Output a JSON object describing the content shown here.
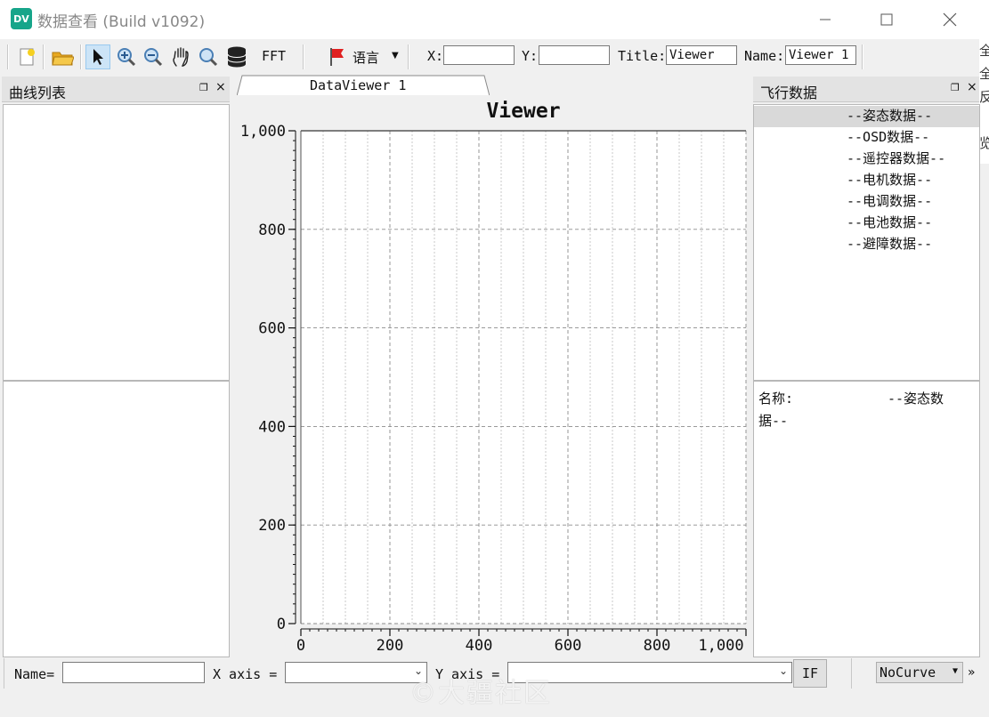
{
  "window": {
    "icon_text": "DV",
    "title": "数据查看  (Build v1092)",
    "accent": "#17a58a"
  },
  "toolbar": {
    "fft_label": "FFT",
    "language_label": "语言",
    "x_label": "X:",
    "x_value": "",
    "y_label": "Y:",
    "y_value": "",
    "title_label": "Title:",
    "title_value": "Viewer",
    "name_label": "Name:",
    "name_value": "Viewer 1",
    "icons": [
      "new-file-icon",
      "open-folder-icon",
      "pointer-icon",
      "zoom-in-icon",
      "zoom-out-icon",
      "pan-hand-icon",
      "zoom-fit-icon",
      "database-icon",
      "flag-icon"
    ]
  },
  "edge_strip": {
    "chars": [
      "全",
      "全",
      "反",
      "",
      "",
      "览"
    ]
  },
  "left_dock": {
    "title": "曲线列表",
    "float_icon": "float-icon",
    "close_icon": "close-icon"
  },
  "tab": {
    "label": "DataViewer 1"
  },
  "chart_data": {
    "type": "line",
    "title": "Viewer",
    "xlim": [
      0,
      1000
    ],
    "ylim": [
      0,
      1000
    ],
    "x_ticks": [
      "0",
      "200",
      "400",
      "600",
      "800",
      "1,000"
    ],
    "y_ticks": [
      "0",
      "200",
      "400",
      "600",
      "800",
      "1,000"
    ],
    "grid": true,
    "series": []
  },
  "right_dock": {
    "title": "飞行数据",
    "items": [
      {
        "label": "--姿态数据--",
        "selected": true
      },
      {
        "label": "--OSD数据--",
        "selected": false
      },
      {
        "label": "--遥控器数据--",
        "selected": false
      },
      {
        "label": "--电机数据--",
        "selected": false
      },
      {
        "label": "--电调数据--",
        "selected": false
      },
      {
        "label": "--电池数据--",
        "selected": false
      },
      {
        "label": "--避障数据--",
        "selected": false
      }
    ],
    "detail_label": "名称:",
    "detail_value_line1": "--姿态数",
    "detail_value_line2": "据--"
  },
  "bottom": {
    "name_label": "Name=",
    "name_value": "",
    "x_axis_label": "X axis =",
    "x_axis_value": "",
    "y_axis_label": "Y axis =",
    "y_axis_value": "",
    "if_label": "IF",
    "curve_value": "NoCurve",
    "more_label": "»",
    "watermark": "©大疆社区"
  }
}
